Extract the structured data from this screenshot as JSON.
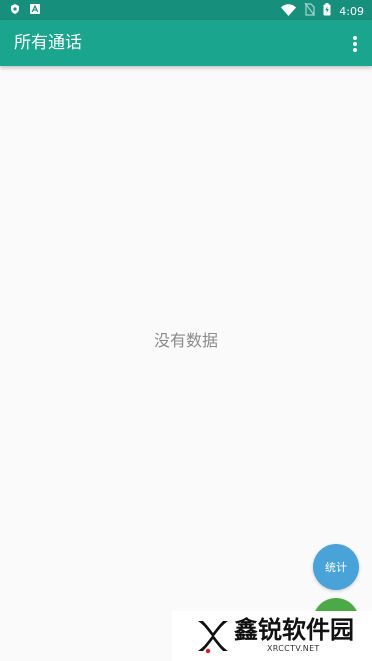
{
  "status_bar": {
    "time": "4:09",
    "left_icons": [
      "shield-icon",
      "a-icon"
    ],
    "right_icons": [
      "wifi-icon",
      "no-sim-icon",
      "battery-icon"
    ]
  },
  "app_bar": {
    "title": "所有通话",
    "menu_icon": "more-vert-icon"
  },
  "content": {
    "empty_message": "没有数据"
  },
  "fab": {
    "stats_label": "统计"
  },
  "watermark": {
    "main": "鑫锐软件园",
    "sub": "XRCCTV.NET"
  },
  "colors": {
    "status_bar": "#178f7d",
    "app_bar": "#1aa58f",
    "background": "#fafafa",
    "fab_stats": "#4aa3d8",
    "fab_green": "#4aaa46"
  }
}
